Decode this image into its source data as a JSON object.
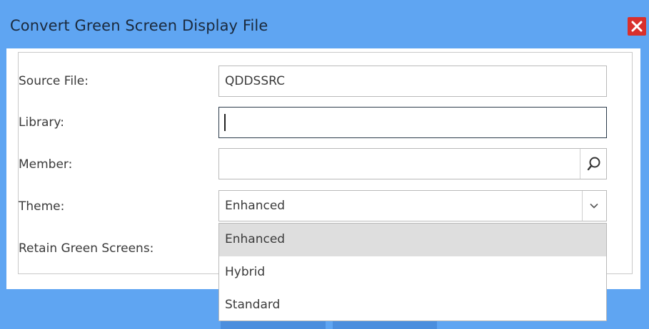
{
  "dialog": {
    "title": "Convert Green Screen Display File",
    "close_icon": "close-x"
  },
  "form": {
    "source_file": {
      "label": "Source File:",
      "value": "QDDSSRC"
    },
    "library": {
      "label": "Library:",
      "value": ""
    },
    "member": {
      "label": "Member:",
      "value": "",
      "search_icon": "search-icon"
    },
    "theme": {
      "label": "Theme:",
      "value": "Enhanced",
      "dropdown_icon": "chevron-down-icon"
    },
    "retain_green_screens": {
      "label": "Retain Green Screens:"
    }
  },
  "theme_dropdown": {
    "options": [
      "Enhanced",
      "Hybrid",
      "Standard"
    ],
    "selected": "Enhanced"
  },
  "colors": {
    "title_bar": "#5fa5f2",
    "close_button": "#d9302c",
    "selected_option": "#dedede"
  }
}
